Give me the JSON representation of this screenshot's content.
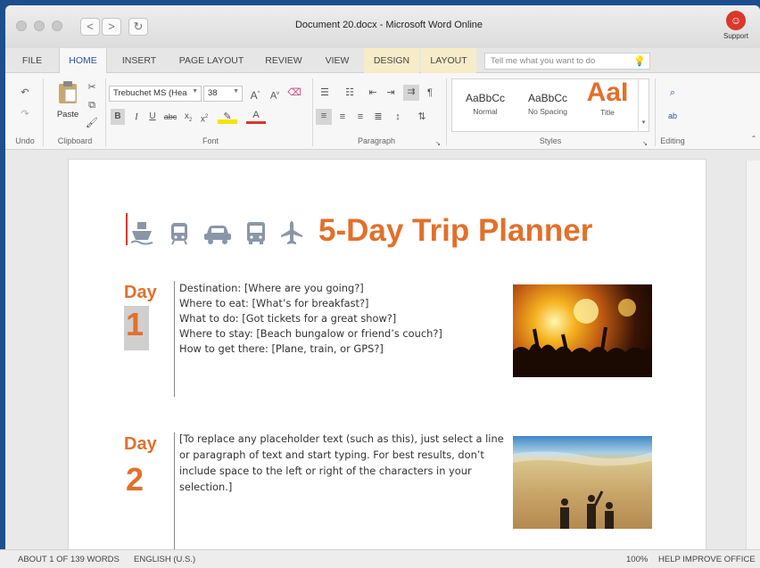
{
  "window": {
    "title": "Document 20.docx - Microsoft Word Online"
  },
  "nav": {
    "back": "<",
    "forward": ">",
    "refresh": "↻"
  },
  "support": {
    "label": "Support"
  },
  "tabs": [
    "FILE",
    "HOME",
    "INSERT",
    "PAGE LAYOUT",
    "REVIEW",
    "VIEW",
    "DESIGN",
    "LAYOUT"
  ],
  "active_tab": "HOME",
  "tellme": {
    "placeholder": "Tell me what you want to do"
  },
  "ribbon": {
    "groups": {
      "undo": "Undo",
      "clipboard": "Clipboard",
      "font": "Font",
      "paragraph": "Paragraph",
      "styles": "Styles",
      "editing": "Editing"
    },
    "paste_label": "Paste",
    "font_name": "Trebuchet MS (Hea",
    "font_size": "38",
    "styles": [
      {
        "sample": "AaBbCc",
        "name": "Normal"
      },
      {
        "sample": "AaBbCc",
        "name": "No Spacing"
      },
      {
        "sample": "AaI",
        "name": "Title"
      }
    ]
  },
  "document": {
    "title": "5-Day Trip Planner",
    "days": [
      {
        "label": "Day",
        "number": "1",
        "lines": [
          "Destination: [Where are you going?]",
          "Where to eat: [What’s for breakfast?]",
          "What to do: [Got tickets for a great show?]",
          "Where to stay: [Beach bungalow or friend’s couch?]",
          "How to get there: [Plane, train, or GPS?]"
        ]
      },
      {
        "label": "Day",
        "number": "2",
        "paragraph": "[To replace any placeholder text (such as this), just select a line or paragraph of text and start typing. For best results, don’t include space to the left or right of the characters in your selection.]"
      }
    ]
  },
  "status": {
    "words": "ABOUT 1 OF 139 WORDS",
    "language": "ENGLISH (U.S.)",
    "zoom": "100%",
    "help": "HELP IMPROVE OFFICE"
  },
  "colors": {
    "accent": "#e2702b",
    "brand": "#2b579a",
    "support": "#d9382b"
  }
}
